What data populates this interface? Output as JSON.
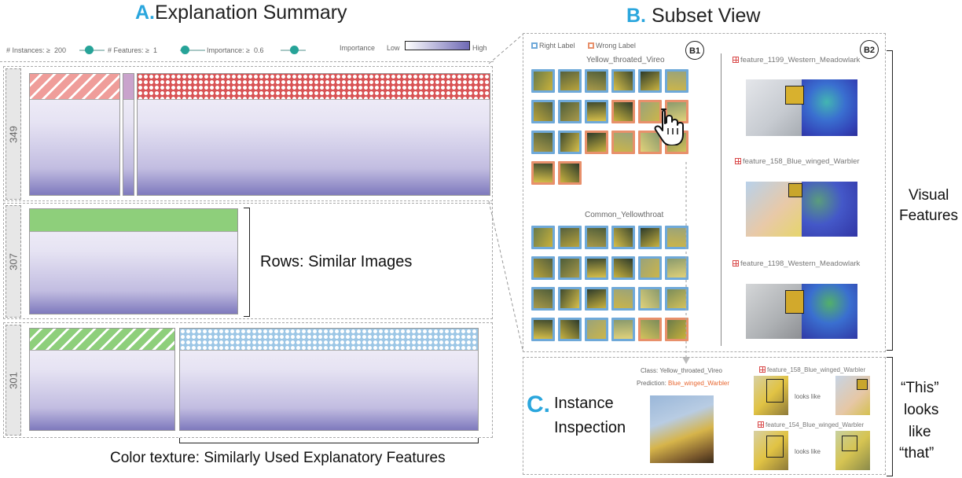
{
  "sections": {
    "a_letter": "A.",
    "a_title": "Explanation Summary",
    "b_letter": "B.",
    "b_title": "Subset View",
    "c_letter": "C.",
    "c_title_1": "Instance",
    "c_title_2": "Inspection"
  },
  "controls": {
    "instances_label": "# Instances: ≥",
    "instances_value": "200",
    "features_label": "# Features: ≥",
    "features_value": "1",
    "importance_label": "Importance: ≥",
    "importance_value": "0.6",
    "legend_label": "Importance",
    "legend_low": "Low",
    "legend_high": "High"
  },
  "rows": [
    {
      "count": "349"
    },
    {
      "count": "307"
    },
    {
      "count": "301"
    }
  ],
  "annotations": {
    "rows": "Rows: Similar Images",
    "texture": "Color texture: Similarly Used Explanatory Features",
    "visual_1": "Visual",
    "visual_2": "Features",
    "this_1": "“This”",
    "this_2": "looks",
    "this_3": "like",
    "this_4": "“that”"
  },
  "subset": {
    "right_label": "Right Label",
    "wrong_label": "Wrong Label",
    "b1": "B1",
    "b2": "B2",
    "class_1": "Yellow_throated_Vireo",
    "class_2": "Common_Yellowthroat",
    "features": [
      "feature_1199_Western_Meadowlark",
      "feature_158_Blue_winged_Warbler",
      "feature_1198_Western_Meadowlark"
    ]
  },
  "inspection": {
    "class_label": "Class:",
    "class_value": "Yellow_throated_Vireo",
    "pred_label": "Prediction:",
    "pred_value": "Blue_winged_Warbler",
    "feature_1": "feature_158_Blue_winged_Warbler",
    "feature_2": "feature_154_Blue_winged_Warbler",
    "looks_like": "looks like"
  },
  "colors": {
    "accent": "#2aa6dd",
    "right": "#6fa9d9",
    "wrong": "#e8906b",
    "slider": "#26a398"
  }
}
